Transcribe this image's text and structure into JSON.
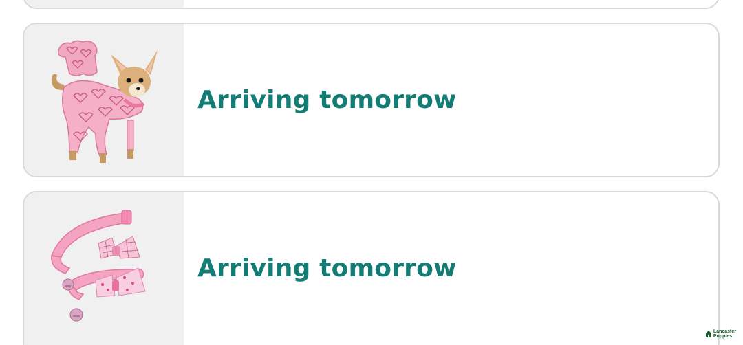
{
  "orders": [
    {
      "product": "pink-heart-dog-pajamas",
      "status": ""
    },
    {
      "product": "pink-heart-dog-pajamas",
      "status": "Arriving tomorrow"
    },
    {
      "product": "pink-bow-pet-collars",
      "status": "Arriving tomorrow"
    }
  ],
  "watermark": {
    "line1": "Lancaster",
    "line2": "Puppies"
  },
  "colors": {
    "status": "#137c74",
    "card_border": "#d9d9d9",
    "thumb_bg": "#f0f0f0"
  },
  "icons": [
    "dog-pajamas-image",
    "bow-collar-image",
    "house-logo-icon"
  ]
}
